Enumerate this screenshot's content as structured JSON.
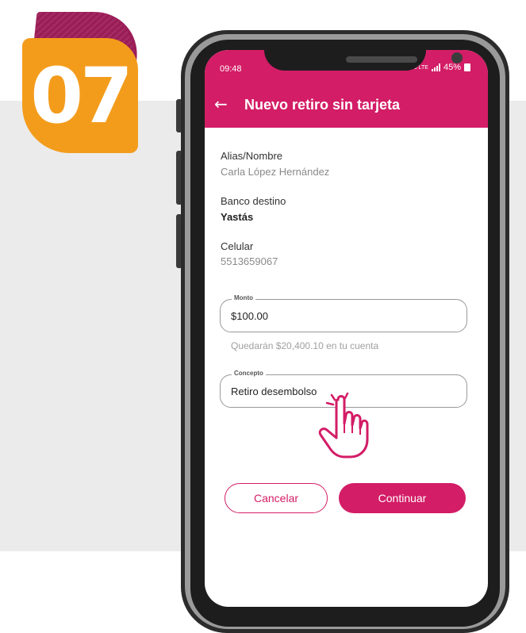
{
  "step": {
    "number": "07"
  },
  "status_bar": {
    "time": "09:48",
    "network": "Vo0 LTE",
    "battery": "45%"
  },
  "app_bar": {
    "title": "Nuevo retiro sin tarjeta",
    "back_icon": "arrow-left-icon"
  },
  "details": {
    "alias_label": "Alias/Nombre",
    "alias_value": "Carla López Hernández",
    "bank_label": "Banco destino",
    "bank_value": "Yastás",
    "phone_label": "Celular",
    "phone_value": "5513659067"
  },
  "form": {
    "amount_label": "Monto",
    "amount_value": "$100.00",
    "helper_text": "Quedarán $20,400.10 en tu cuenta",
    "concept_label": "Concepto",
    "concept_value": "Retiro desembolso"
  },
  "buttons": {
    "cancel": "Cancelar",
    "continue": "Continuar"
  },
  "colors": {
    "brand": "#d31d66",
    "badge_orange": "#f39c1c",
    "badge_back": "#9b1d57"
  }
}
